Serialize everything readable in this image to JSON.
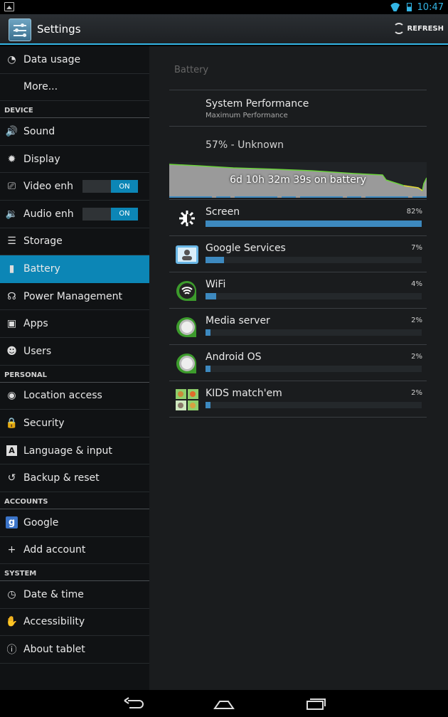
{
  "status_bar": {
    "time": "10:47"
  },
  "action_bar": {
    "title": "Settings",
    "refresh_label": "REFRESH"
  },
  "sidebar": {
    "items": [
      {
        "label": "Data usage",
        "icon": "data-usage-icon"
      },
      {
        "label": "More...",
        "icon": ""
      },
      {
        "header": "DEVICE"
      },
      {
        "label": "Sound",
        "icon": "sound-icon"
      },
      {
        "label": "Display",
        "icon": "display-icon"
      },
      {
        "label": "Video enha",
        "icon": "video-enhance-icon",
        "toggle": "ON"
      },
      {
        "label": "Audio enha",
        "icon": "audio-enhance-icon",
        "toggle": "ON"
      },
      {
        "label": "Storage",
        "icon": "storage-icon"
      },
      {
        "label": "Battery",
        "icon": "battery-icon",
        "selected": true
      },
      {
        "label": "Power Management",
        "icon": "power-management-icon"
      },
      {
        "label": "Apps",
        "icon": "apps-icon"
      },
      {
        "label": "Users",
        "icon": "users-icon"
      },
      {
        "header": "PERSONAL"
      },
      {
        "label": "Location access",
        "icon": "location-icon"
      },
      {
        "label": "Security",
        "icon": "lock-icon"
      },
      {
        "label": "Language & input",
        "icon": "language-icon"
      },
      {
        "label": "Backup & reset",
        "icon": "backup-icon"
      },
      {
        "header": "ACCOUNTS"
      },
      {
        "label": "Google",
        "icon": "google-icon"
      },
      {
        "label": "Add account",
        "icon": "plus-icon"
      },
      {
        "header": "SYSTEM"
      },
      {
        "label": "Date & time",
        "icon": "clock-icon"
      },
      {
        "label": "Accessibility",
        "icon": "hand-icon"
      },
      {
        "label": "About tablet",
        "icon": "info-icon"
      }
    ]
  },
  "battery": {
    "section_title": "Battery",
    "performance_title": "System Performance",
    "performance_sub": "Maximum Performance",
    "level_text": "57% - Unknown",
    "graph_text": "6d 10h 32m 39s on battery",
    "usage": [
      {
        "name": "Screen",
        "pct": "82%",
        "value": 82,
        "icon": "screen-brightness-icon"
      },
      {
        "name": "Google Services",
        "pct": "7%",
        "value": 7,
        "icon": "google-services-icon"
      },
      {
        "name": "WiFi",
        "pct": "4%",
        "value": 4,
        "icon": "wifi-icon"
      },
      {
        "name": "Media server",
        "pct": "2%",
        "value": 2,
        "icon": "media-server-icon"
      },
      {
        "name": "Android OS",
        "pct": "2%",
        "value": 2,
        "icon": "android-os-icon"
      },
      {
        "name": "KIDS match'em",
        "pct": "2%",
        "value": 2,
        "icon": "kids-match-icon"
      }
    ]
  },
  "colors": {
    "accent": "#33b5e5",
    "selected": "#0c86b6",
    "bar": "#3d89bf"
  }
}
